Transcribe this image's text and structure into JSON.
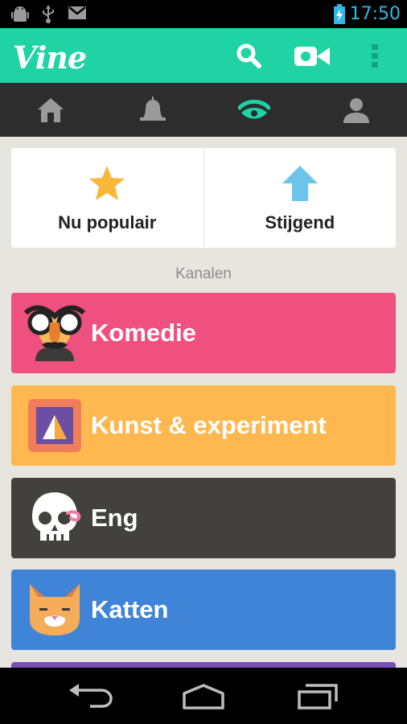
{
  "status_bar": {
    "time": "17:50",
    "icons": [
      "android-debug-icon",
      "usb-icon",
      "gmail-icon",
      "battery-charging-icon"
    ]
  },
  "action_bar": {
    "app_name": "Vine",
    "icons": [
      "search-icon",
      "video-camera-icon",
      "overflow-menu-icon"
    ],
    "brand_color": "#1fd3a4"
  },
  "tabs": [
    {
      "name": "home",
      "icon": "home-icon",
      "active": false
    },
    {
      "name": "notifications",
      "icon": "bell-icon",
      "active": false
    },
    {
      "name": "explore",
      "icon": "eye-icon",
      "active": true
    },
    {
      "name": "profile",
      "icon": "profile-icon",
      "active": false
    }
  ],
  "top_cards": {
    "popular": {
      "label": "Nu populair",
      "icon": "star-icon"
    },
    "trending": {
      "label": "Stijgend",
      "icon": "arrow-up-icon"
    }
  },
  "section_title": "Kanalen",
  "channels": [
    {
      "label": "Komedie",
      "color": "#f0507f",
      "icon": "disguise-glasses-icon"
    },
    {
      "label": "Kunst & experiment",
      "color": "#ffb84f",
      "icon": "picture-frame-icon"
    },
    {
      "label": "Eng",
      "color": "#43413d",
      "icon": "skull-icon"
    },
    {
      "label": "Katten",
      "color": "#3f84d6",
      "icon": "cat-icon"
    }
  ],
  "nav_bar": {
    "icons": [
      "back-icon",
      "home-nav-icon",
      "recent-apps-icon"
    ]
  }
}
